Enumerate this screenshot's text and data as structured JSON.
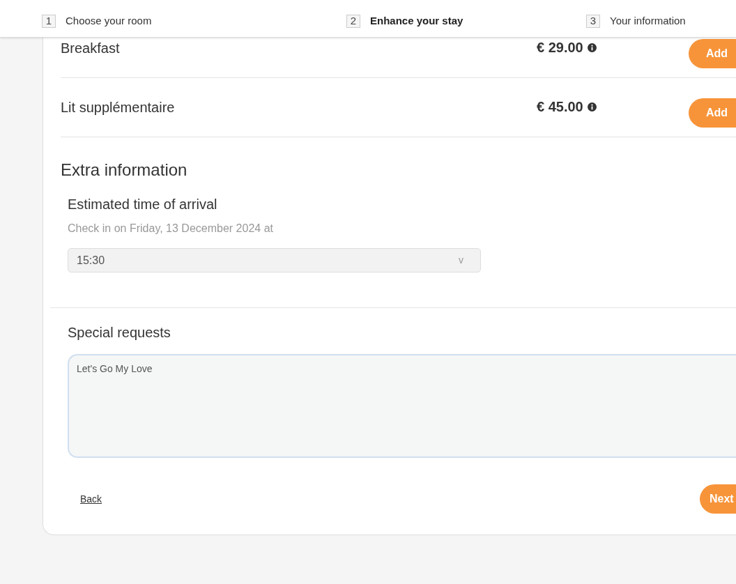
{
  "steps": [
    {
      "number": "1",
      "label": "Choose your room",
      "selected": false
    },
    {
      "number": "2",
      "label": "Enhance your stay",
      "selected": true
    },
    {
      "number": "3",
      "label": "Your information",
      "selected": false
    }
  ],
  "extras": [
    {
      "name": "Breakfast",
      "price": "€ 29.00",
      "button": "Add"
    },
    {
      "name": "Lit supplémentaire",
      "price": "€ 45.00",
      "button": "Add"
    }
  ],
  "extra_information": {
    "title": "Extra information",
    "arrival_title": "Estimated time of arrival",
    "arrival_hint": "Check in on Friday, 13 December 2024 at",
    "arrival_time": "15:30",
    "caret": "v"
  },
  "special_requests": {
    "title": "Special requests",
    "value": "Let's Go My Love"
  },
  "back": "Back",
  "next": "Next"
}
